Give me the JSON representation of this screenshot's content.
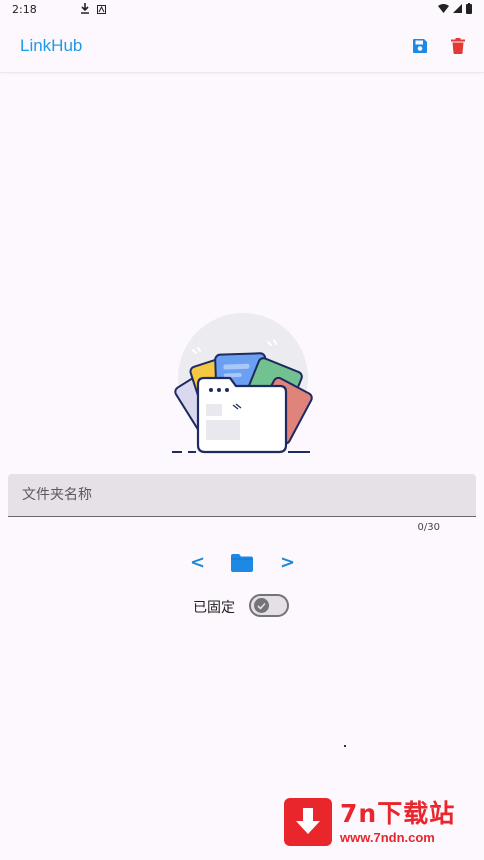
{
  "status_bar": {
    "time": "2:18"
  },
  "app_bar": {
    "title": "LinkHub",
    "save_icon": "save-icon",
    "delete_icon": "trash-icon"
  },
  "form": {
    "name_placeholder": "文件夹名称",
    "name_value": "",
    "char_counter": "0/30"
  },
  "nav": {
    "prev_label": "<",
    "next_label": ">",
    "folder_icon": "folder-icon"
  },
  "pin": {
    "label": "已固定",
    "checked": true
  },
  "watermark": {
    "brand": "7n下载站",
    "url": "www.7ndn.com"
  },
  "colors": {
    "accent": "#1e9be8",
    "delete": "#e53935",
    "background": "#fdf8fd",
    "field": "#e6e1e6",
    "watermark": "#e8262b"
  }
}
